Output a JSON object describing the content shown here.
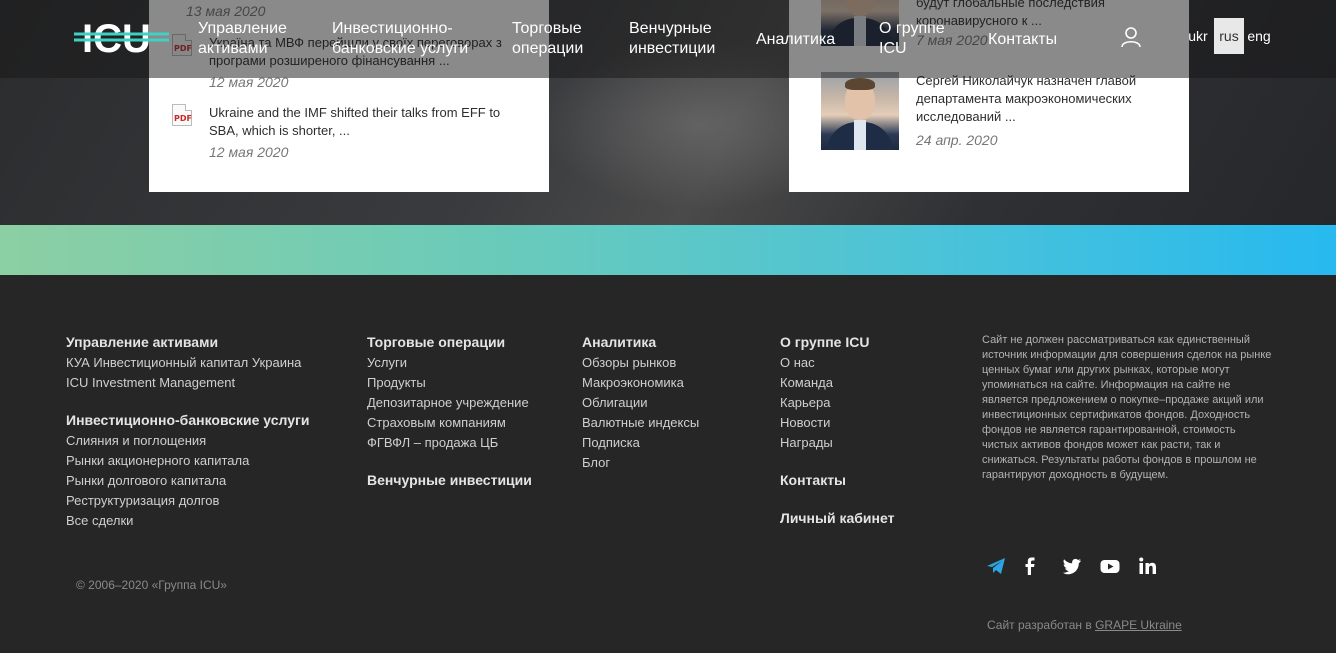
{
  "header": {
    "logo_text": "ICU",
    "nav": [
      {
        "line1": "Управление",
        "line2": "активами"
      },
      {
        "line1": "Инвестиционно-",
        "line2": "банковские услуги"
      },
      {
        "line1": "Торговые",
        "line2": "операции"
      },
      {
        "line1": "Венчурные",
        "line2": "инвестиции"
      },
      {
        "line1": "Аналитика",
        "line2": ""
      },
      {
        "line1": "О группе",
        "line2": "ICU"
      },
      {
        "line1": "Контакты",
        "line2": ""
      }
    ],
    "languages": [
      "ukr",
      "rus",
      "eng"
    ],
    "active_language": "rus"
  },
  "publications": [
    {
      "text": "",
      "date": "13 мая 2020"
    },
    {
      "text": "Україна та МВФ перейшли у своїх переговорах з програми розширеного фінансування ...",
      "date": "12 мая 2020"
    },
    {
      "text": "Ukraine and the IMF shifted their talks from EFF to SBA, which is shorter, ...",
      "date": "12 мая 2020"
    }
  ],
  "pdf_label": "PDF",
  "news": [
    {
      "text": "будут глобальные последствия коронавирусного к ...",
      "date": "7 мая 2020"
    },
    {
      "text": "Сергей Николайчук назначен главой департамента макроэкономических исследований ...",
      "date": "24 апр. 2020"
    }
  ],
  "footer": {
    "col1": {
      "heading1": "Управление активами",
      "links1": [
        "КУА Инвестиционный капитал Украина",
        "ICU Investment Management"
      ],
      "heading2": "Инвестиционно-банковские услуги",
      "links2": [
        "Слияния и поглощения",
        "Рынки акционерного капитала",
        "Рынки долгового капитала",
        "Реструктуризация долгов",
        "Все сделки"
      ]
    },
    "col2": {
      "heading1": "Торговые операции",
      "links1": [
        "Услуги",
        "Продукты",
        "Депозитарное учреждение",
        "Страховым компаниям",
        "ФГВФЛ – продажа ЦБ"
      ],
      "heading2": "Венчурные инвестиции"
    },
    "col3": {
      "heading": "Аналитика",
      "links": [
        "Обзоры рынков",
        "Макроэкономика",
        "Облигации",
        "Валютные индексы",
        "Подписка",
        "Блог"
      ]
    },
    "col4": {
      "heading": "О группе ICU",
      "links": [
        "О нас",
        "Команда",
        "Карьера",
        "Новости",
        "Награды"
      ],
      "heading2": "Контакты",
      "heading3": "Личный кабинет"
    },
    "disclaimer": "Сайт не должен рассматриваться как единственный источник информации для совершения сделок на рынке ценных бумаг или других рынках, которые могут упоминаться на сайте. Информация на сайте не является предложением о покупке–продаже акций или инвестиционных сертификатов фондов. Доходность фондов не является гарантированной, стоимость чистых активов фондов может как расти, так и снижаться. Результаты работы фондов в прошлом не гарантируют доходность в будущем.",
    "copyright": "© 2006–2020 «Группа ICU»",
    "developer_prefix": "Сайт разработан в ",
    "developer_link": "GRAPE Ukraine",
    "social": [
      "telegram-icon",
      "facebook-icon",
      "twitter-icon",
      "youtube-icon",
      "linkedin-icon"
    ]
  },
  "colors": {
    "accent_teal": "#3fd1c4",
    "band_start": "#8ccfa3",
    "band_end": "#27b9ef",
    "footer_bg": "#262626",
    "telegram": "#2ca5e0"
  }
}
